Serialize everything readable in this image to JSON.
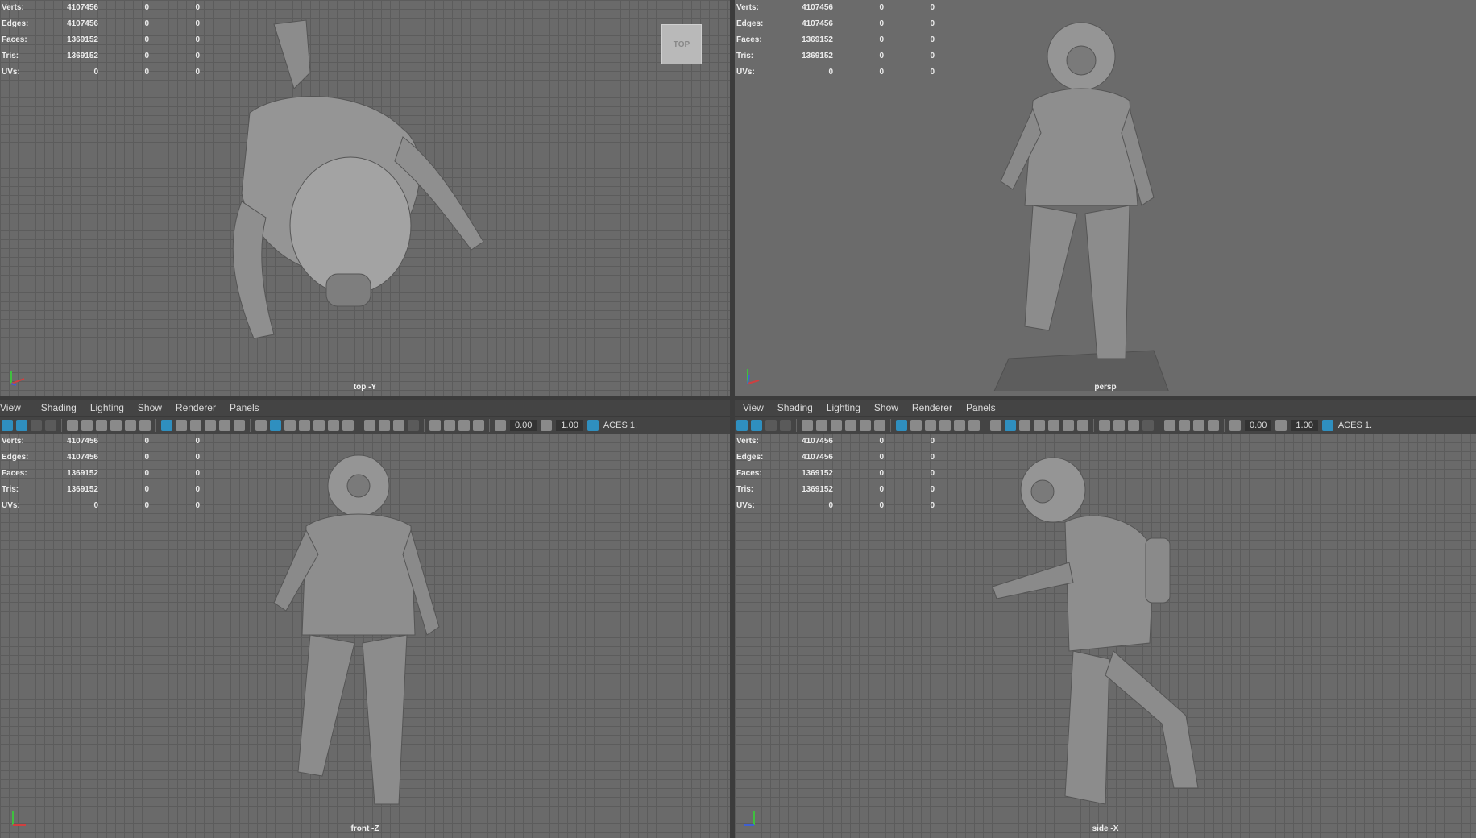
{
  "menus": [
    "View",
    "Shading",
    "Lighting",
    "Show",
    "Renderer",
    "Panels"
  ],
  "toolbar": {
    "exposure": "0.00",
    "gamma": "1.00",
    "colorspace": "ACES 1."
  },
  "stats": {
    "rows": [
      {
        "label": "Verts:",
        "value": "4107456",
        "a": "0",
        "b": "0"
      },
      {
        "label": "Edges:",
        "value": "4107456",
        "a": "0",
        "b": "0"
      },
      {
        "label": "Faces:",
        "value": "1369152",
        "a": "0",
        "b": "0"
      },
      {
        "label": "Tris:",
        "value": "1369152",
        "a": "0",
        "b": "0"
      },
      {
        "label": "UVs:",
        "value": "0",
        "a": "0",
        "b": "0"
      }
    ]
  },
  "viewports": {
    "top": {
      "label": "top -Y",
      "cube": "TOP"
    },
    "persp": {
      "label": "persp"
    },
    "front": {
      "label": "front -Z"
    },
    "side": {
      "label": "side -X"
    }
  },
  "colors": {
    "accent": "#2f8fbf",
    "grid": "#5c5c5c",
    "viewport_bg": "#6a6a6a",
    "panel_bg": "#444444"
  }
}
